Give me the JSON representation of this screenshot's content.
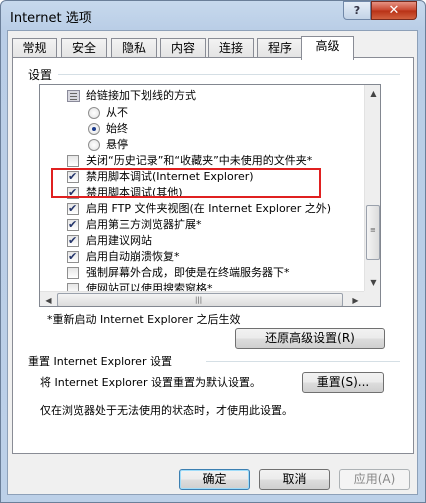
{
  "window": {
    "title": "Internet 选项",
    "help_glyph": "?",
    "close_glyph": "✕"
  },
  "tabs": [
    {
      "label": "常规"
    },
    {
      "label": "安全"
    },
    {
      "label": "隐私"
    },
    {
      "label": "内容"
    },
    {
      "label": "连接"
    },
    {
      "label": "程序"
    },
    {
      "label": "高级",
      "active": true
    }
  ],
  "settings": {
    "group_label": "设置",
    "items": [
      {
        "type": "heading",
        "label": "给链接加下划线的方式",
        "icon": "settings-folder-icon"
      },
      {
        "type": "radio",
        "label": "从不",
        "checked": false
      },
      {
        "type": "radio",
        "label": "始终",
        "checked": true
      },
      {
        "type": "radio",
        "label": "悬停",
        "checked": false
      },
      {
        "type": "checkbox",
        "label": "关闭“历史记录”和“收藏夹”中未使用的文件夹*",
        "checked": false
      },
      {
        "type": "checkbox",
        "label": "禁用脚本调试(Internet Explorer)",
        "checked": true
      },
      {
        "type": "checkbox",
        "label": "禁用脚本调试(其他)",
        "checked": true
      },
      {
        "type": "checkbox",
        "label": "启用 FTP 文件夹视图(在 Internet Explorer 之外)",
        "checked": true
      },
      {
        "type": "checkbox",
        "label": "启用第三方浏览器扩展*",
        "checked": true
      },
      {
        "type": "checkbox",
        "label": "启用建议网站",
        "checked": true
      },
      {
        "type": "checkbox",
        "label": "启用自动崩溃恢复*",
        "checked": true
      },
      {
        "type": "checkbox",
        "label": "强制屏幕外合成，即使是在终端服务器下*",
        "checked": false
      },
      {
        "type": "checkbox",
        "label": "使网站可以使用搜索窗格*",
        "checked": false
      }
    ],
    "restart_note": "*重新启动 Internet Explorer 之后生效",
    "restore_button": "还原高级设置(R)"
  },
  "reset": {
    "group_label": "重置 Internet Explorer 设置",
    "description": "将 Internet Explorer 设置重置为默认设置。",
    "button": "重置(S)...",
    "note": "仅在浏览器处于无法使用的状态时，才使用此设置。"
  },
  "footer": {
    "ok": "确定",
    "cancel": "取消",
    "apply": "应用(A)"
  }
}
